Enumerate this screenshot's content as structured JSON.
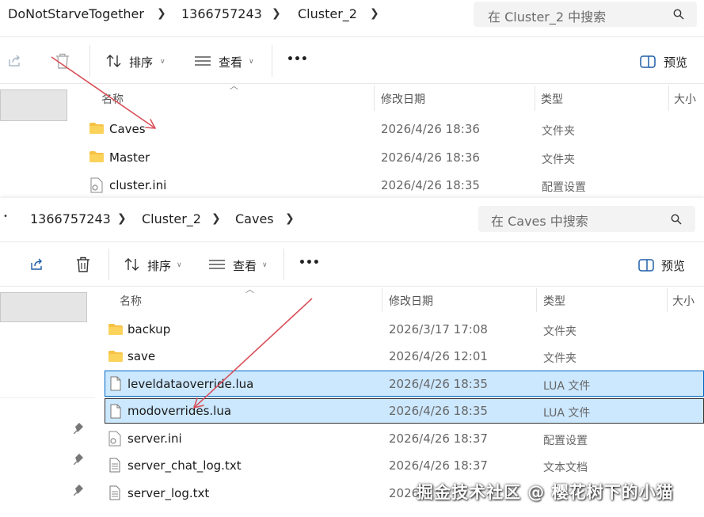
{
  "window1": {
    "breadcrumbs": [
      "DoNotStarveTogether",
      "1366757243",
      "Cluster_2"
    ],
    "search_placeholder": "在 Cluster_2 中搜索",
    "toolbar": {
      "sort_label": "排序",
      "view_label": "查看",
      "more_label": "•••",
      "preview_label": "预览"
    },
    "columns": {
      "name": "名称",
      "modified": "修改日期",
      "type": "类型",
      "size": "大小"
    },
    "files": [
      {
        "name": "Caves",
        "modified": "2026/4/26 18:36",
        "type": "文件夹",
        "icon": "folder-icon"
      },
      {
        "name": "Master",
        "modified": "2026/4/26 18:36",
        "type": "文件夹",
        "icon": "folder-icon"
      },
      {
        "name": "cluster.ini",
        "modified": "2026/4/26 18:35",
        "type": "配置设置",
        "icon": "config-file-icon"
      }
    ]
  },
  "window2": {
    "breadcrumbs": [
      "1366757243",
      "Cluster_2",
      "Caves"
    ],
    "search_placeholder": "在 Caves 中搜索",
    "toolbar": {
      "sort_label": "排序",
      "view_label": "查看",
      "more_label": "•••",
      "preview_label": "预览"
    },
    "columns": {
      "name": "名称",
      "modified": "修改日期",
      "type": "类型",
      "size": "大小"
    },
    "files": [
      {
        "name": "backup",
        "modified": "2026/3/17 17:08",
        "type": "文件夹",
        "icon": "folder-icon"
      },
      {
        "name": "save",
        "modified": "2026/4/26 12:01",
        "type": "文件夹",
        "icon": "folder-icon"
      },
      {
        "name": "leveldataoverride.lua",
        "modified": "2026/4/26 18:35",
        "type": "LUA 文件",
        "icon": "document-icon",
        "selected": true
      },
      {
        "name": "modoverrides.lua",
        "modified": "2026/4/26 18:35",
        "type": "LUA 文件",
        "icon": "document-icon",
        "selected": true,
        "focused": true
      },
      {
        "name": "server.ini",
        "modified": "2026/4/26 18:37",
        "type": "配置设置",
        "icon": "config-file-icon"
      },
      {
        "name": "server_chat_log.txt",
        "modified": "2026/4/26 18:37",
        "type": "文本文档",
        "icon": "text-file-icon"
      },
      {
        "name": "server_log.txt",
        "modified": "2026/",
        "type": "",
        "icon": "text-file-icon"
      }
    ]
  },
  "watermark": "掘金技术社区 @ 樱花树下的小猫",
  "colors": {
    "selection": "#cce8ff",
    "arrow": "#d9505a",
    "folder": "#f6c244"
  }
}
